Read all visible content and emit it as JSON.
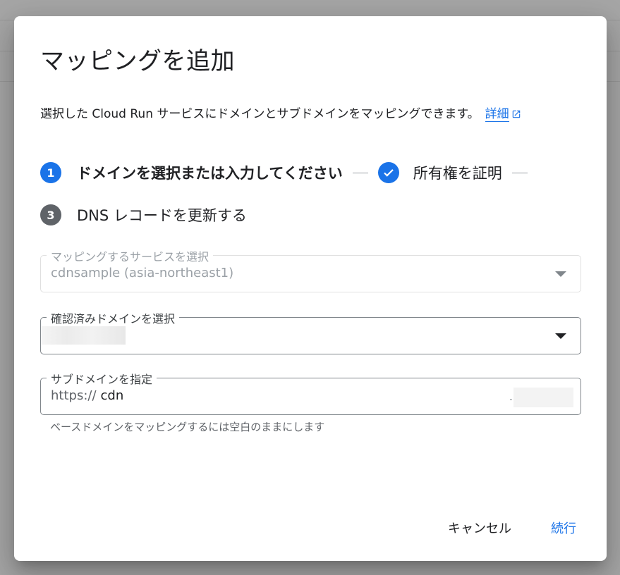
{
  "dialog": {
    "title": "マッピングを追加",
    "description": "選択した Cloud Run サービスにドメインとサブドメインをマッピングできます。",
    "learn_more_link": "詳細"
  },
  "steps": [
    {
      "number": "1",
      "label": "ドメインを選択または入力してください",
      "state": "active"
    },
    {
      "number": "",
      "label": "所有権を証明",
      "state": "completed"
    },
    {
      "number": "3",
      "label": "DNS レコードを更新する",
      "state": "pending"
    }
  ],
  "fields": {
    "service": {
      "label": "マッピングするサービスを選択",
      "value": "cdnsample (asia-northeast1)",
      "disabled": true
    },
    "domain": {
      "label": "確認済みドメインを選択",
      "value": ""
    },
    "subdomain": {
      "label": "サブドメインを指定",
      "prefix": "https://",
      "value": "cdn",
      "dot": ".",
      "hint": "ベースドメインをマッピングするには空白のままにします"
    }
  },
  "buttons": {
    "cancel": "キャンセル",
    "continue": "続行"
  },
  "colors": {
    "accent": "#1a73e8",
    "pending_step": "#5f6368",
    "scrim": "#a6a6a6"
  }
}
